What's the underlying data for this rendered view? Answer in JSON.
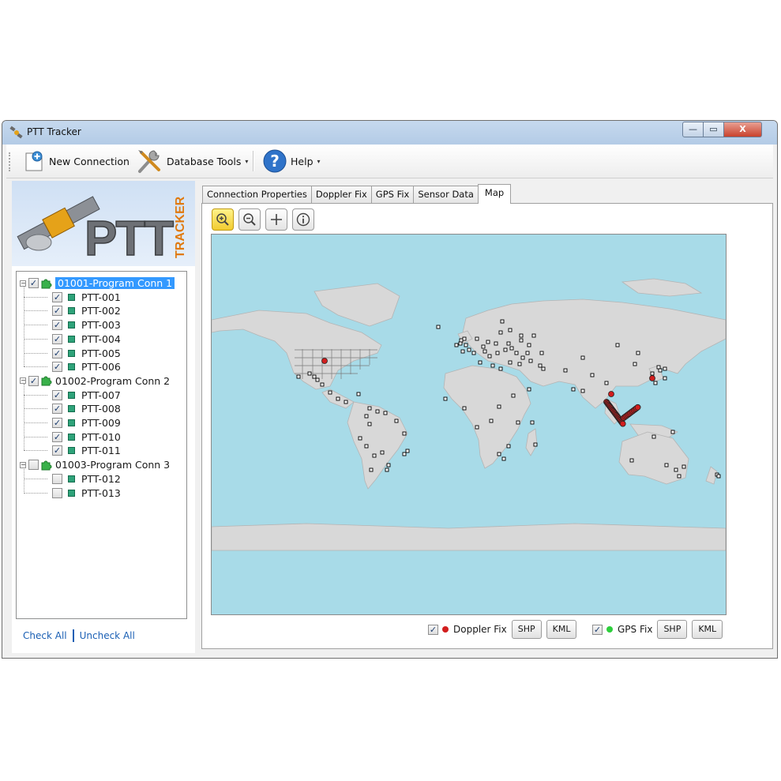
{
  "window": {
    "title": "PTT Tracker",
    "min_glyph": "—",
    "max_glyph": "▭",
    "close_glyph": "X"
  },
  "toolbar": {
    "new_connection": "New Connection",
    "database_tools": "Database Tools",
    "help": "Help",
    "caret": "▾"
  },
  "logo": {
    "main": "PTT",
    "sub": "TRACKER"
  },
  "tree": {
    "groups": [
      {
        "label": "01001-Program Conn 1",
        "checked": true,
        "children": [
          "PTT-001",
          "PTT-002",
          "PTT-003",
          "PTT-004",
          "PTT-005",
          "PTT-006"
        ]
      },
      {
        "label": "01002-Program Conn 2",
        "checked": true,
        "children": [
          "PTT-007",
          "PTT-008",
          "PTT-009",
          "PTT-010",
          "PTT-011"
        ]
      },
      {
        "label": "01003-Program Conn 3",
        "checked": false,
        "children": [
          "PTT-012",
          "PTT-013"
        ]
      }
    ],
    "check_glyph": "✓",
    "expander_glyph": "−"
  },
  "links": {
    "check_all": "Check All",
    "uncheck_all": "Uncheck All"
  },
  "tabs": [
    "Connection Properties",
    "Doppler Fix",
    "GPS Fix",
    "Sensor Data",
    "Map"
  ],
  "legend": {
    "doppler": {
      "label": "Doppler Fix",
      "color": "#d21e1e",
      "shp": "SHP",
      "kml": "KML"
    },
    "gps": {
      "label": "GPS Fix",
      "color": "#2dcf3c",
      "shp": "SHP",
      "kml": "KML"
    }
  },
  "colors": {
    "ocean": "#a8dbe8",
    "land": "#d8d8d8",
    "selection": "#3399ff"
  }
}
